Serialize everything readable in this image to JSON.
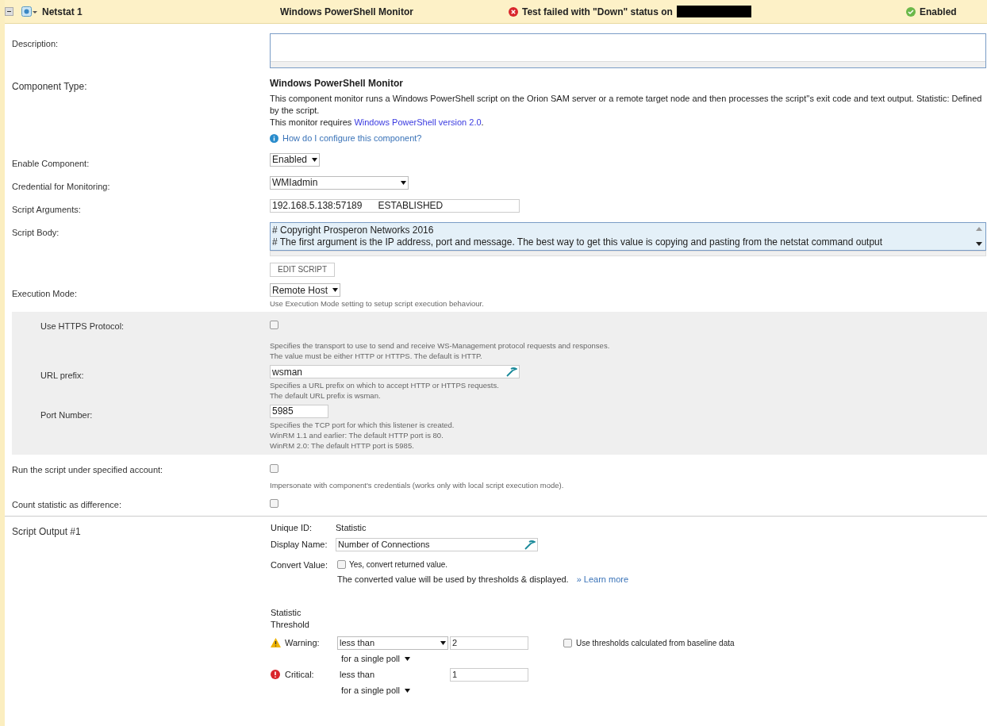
{
  "header": {
    "expanded": true,
    "name": "Netstat 1",
    "type": "Windows PowerShell Monitor",
    "status": {
      "kind": "failed",
      "text": "Test failed with \"Down\" status on"
    },
    "enabled": {
      "kind": "ok",
      "text": "Enabled"
    }
  },
  "description": {
    "label": "Description:"
  },
  "component_type": {
    "label": "Component Type:",
    "title": "Windows PowerShell Monitor",
    "text": "This component monitor runs a Windows PowerShell script on the Orion SAM server or a remote target node and then processes the script''s exit code and text output. Statistic: Defined by the script.",
    "requires": "This monitor requires",
    "link": "Windows PowerShell version 2.0",
    "after_link": ".",
    "help": "How do I configure this component?"
  },
  "enable_component": {
    "label": "Enable Component:",
    "value": "Enabled"
  },
  "credential": {
    "label": "Credential for Monitoring:",
    "value": "WMIadmin"
  },
  "script_arguments": {
    "label": "Script Arguments:",
    "value": "192.168.5.138:57189      ESTABLISHED"
  },
  "script_body": {
    "label": "Script Body:",
    "lines": [
      "# Copyright Prosperon Networks 2016",
      "# The first argument is the IP address, port and message. The best way to get this value is copying and pasting from the netstat command output"
    ],
    "button": "EDIT SCRIPT"
  },
  "execution_mode": {
    "label": "Execution Mode:",
    "value": "Remote Host",
    "hint": "Use Execution Mode setting to setup script execution behaviour."
  },
  "remote_settings": [
    {
      "kind": "checkbox",
      "label": "Use HTTPS Protocol:",
      "checked": false,
      "hints": [
        "Specifies the transport to use to send and receive WS-Management protocol requests and responses.",
        "The value must be either HTTP or HTTPS. The default is HTTP."
      ]
    },
    {
      "kind": "text_with_icon",
      "label": "URL prefix:",
      "value": "wsman",
      "hints": [
        "Specifies a URL prefix on which to accept HTTP or HTTPS requests.",
        "The default URL prefix is wsman."
      ]
    },
    {
      "kind": "short_text",
      "label": "Port Number:",
      "value": "5985",
      "hints": [
        "Specifies the TCP port for which this listener is created.",
        "WinRM 1.1 and earlier: The default HTTP port is 80.",
        "WinRM 2.0: The default HTTP port is 5985."
      ]
    }
  ],
  "run_under_account": {
    "label": "Run the script under specified account:",
    "checked": false,
    "hint": "Impersonate with component's credentials (works only with local script execution mode)."
  },
  "count_difference": {
    "label": "Count statistic as difference:",
    "checked": false
  },
  "script_output": {
    "label": "Script Output #1",
    "unique_id_label": "Unique ID:",
    "unique_id": "Statistic",
    "display_name_label": "Display Name:",
    "display_name": "Number of Connections",
    "convert_label": "Convert Value:",
    "convert_checked": false,
    "convert_text": "Yes, convert returned value.",
    "convert_note": "The converted value will be used by thresholds & displayed.",
    "learn_more": "» Learn more",
    "threshold_title_1": "Statistic",
    "threshold_title_2": "Threshold",
    "thresholds": [
      {
        "kind": "warning",
        "label": "Warning:",
        "operator": "less than",
        "operator_dropdown": true,
        "value": "2",
        "poll": "for a single poll"
      },
      {
        "kind": "critical",
        "label": "Critical:",
        "operator": "less than",
        "operator_dropdown": false,
        "value": "1",
        "poll": "for a single poll"
      }
    ],
    "baseline_checked": false,
    "baseline_text": "Use thresholds calculated from baseline data"
  }
}
